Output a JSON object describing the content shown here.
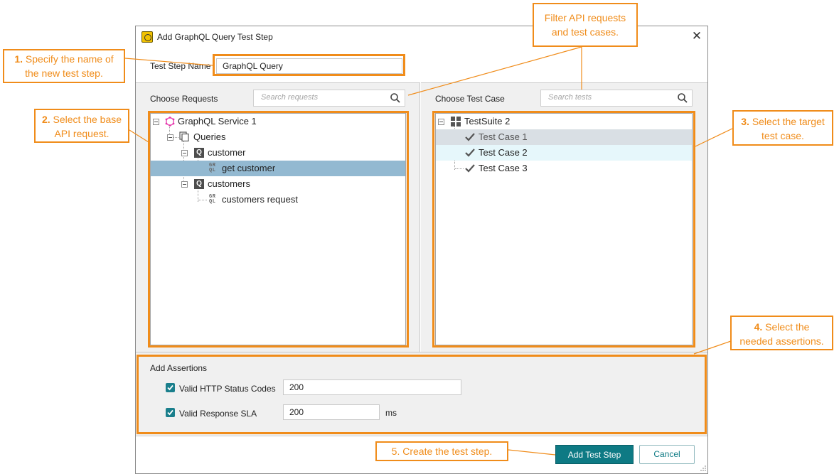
{
  "dialog": {
    "title": "Add GraphQL Query Test Step",
    "close_label": "✕",
    "test_step_name_label": "Test Step Name",
    "test_step_name_value": "GraphQL Query"
  },
  "requests": {
    "label": "Choose Requests",
    "search_placeholder": "Search requests",
    "tree": {
      "service": "GraphQL Service 1",
      "queries": "Queries",
      "customer": "customer",
      "get_customer": "get customer",
      "customers": "customers",
      "customers_request": "customers request",
      "selected": "get customer"
    }
  },
  "tests": {
    "label": "Choose Test Case",
    "search_placeholder": "Search tests",
    "tree": {
      "suite": "TestSuite 2",
      "cases": [
        "Test Case 1",
        "Test Case 2",
        "Test Case 3"
      ]
    }
  },
  "assertions": {
    "label": "Add Assertions",
    "items": [
      {
        "label": "Valid HTTP Status Codes",
        "value": "200",
        "checked": true
      },
      {
        "label": "Valid Response SLA",
        "value": "200",
        "unit": "ms",
        "checked": true
      }
    ]
  },
  "footer": {
    "add_label": "Add Test Step",
    "cancel_label": "Cancel"
  },
  "callouts": {
    "c1": {
      "num": "1.",
      "text1": "Specify the name of",
      "text2": "the new test step."
    },
    "c2": {
      "num": "2.",
      "text1": "Select the base",
      "text2": "API request."
    },
    "c3": {
      "num": "3.",
      "text1": "Select the target",
      "text2": "test case."
    },
    "c4": {
      "num": "4.",
      "text1": "Select the",
      "text2": "needed assertions."
    },
    "c5": {
      "text": "5. Create the test step."
    },
    "filter": {
      "text1": "Filter API requests",
      "text2": "and test cases."
    }
  },
  "colors": {
    "accent": "#0e7a84",
    "callout": "#f08c1a",
    "selection_left": "#93b9d1",
    "selection_right": "#d9dfe4",
    "hover_right": "#e6f7fb"
  }
}
